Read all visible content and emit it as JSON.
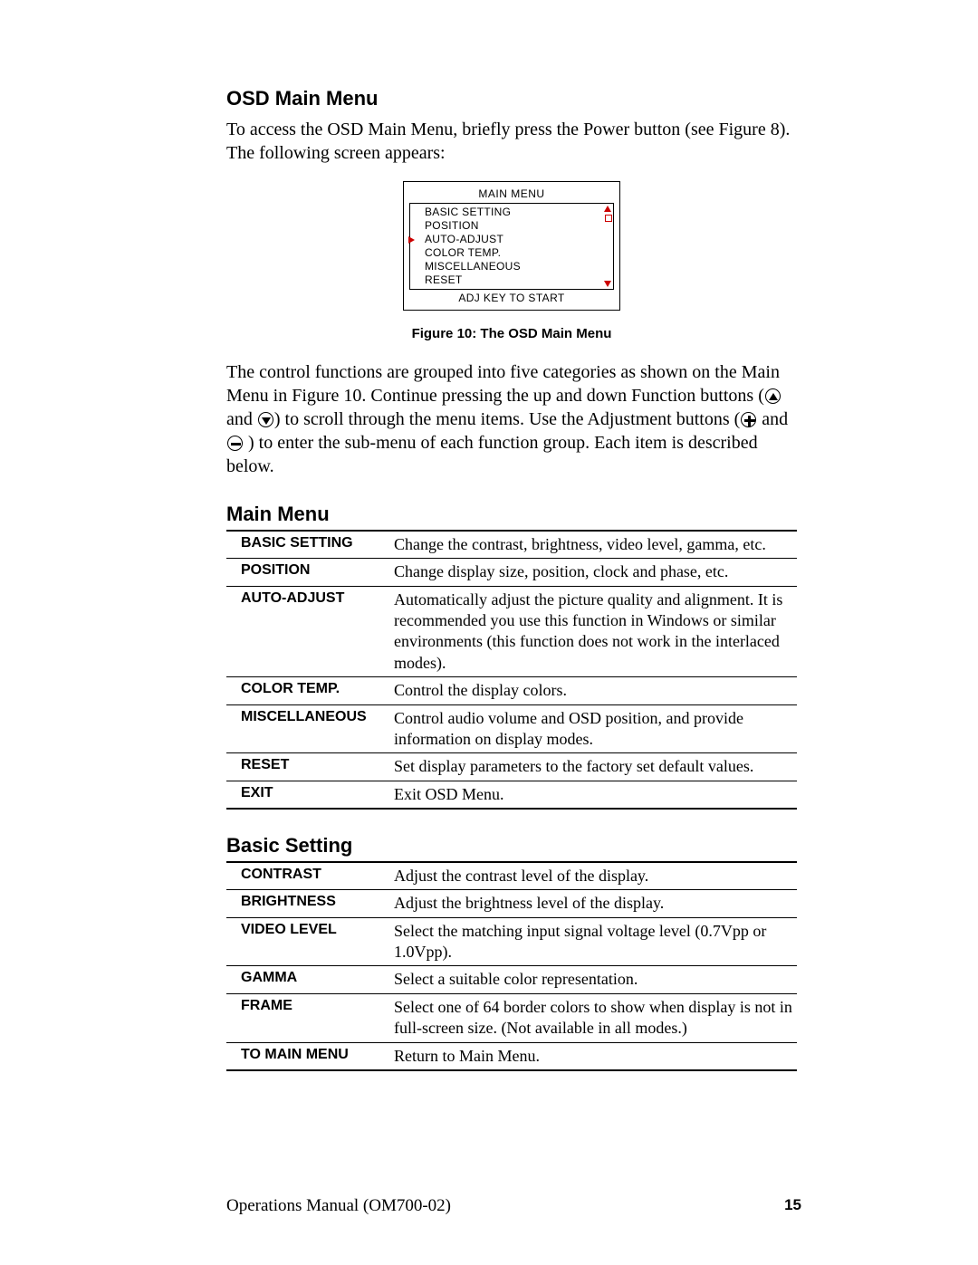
{
  "heading": "OSD Main Menu",
  "intro": "To access the OSD Main Menu, briefly press the Power button (see Figure 8). The following screen appears:",
  "figure": {
    "title": "MAIN MENU",
    "items": [
      "BASIC SETTING",
      "POSITION",
      "AUTO-ADJUST",
      "COLOR TEMP.",
      "MISCELLANEOUS",
      "RESET"
    ],
    "selected_index": 2,
    "footer": "ADJ KEY TO START",
    "caption": "Figure 10: The OSD Main Menu"
  },
  "desc": {
    "seg1": "The control functions are grouped into five categories as shown on the Main Menu in Figure 10. Continue pressing the up and down Function buttons (",
    "seg_and1": " and ",
    "seg2": ") to scroll through the menu items. Use the Adjustment buttons (",
    "seg_and2": " and ",
    "seg3": " ) to enter the sub-menu of each function group. Each item is described below."
  },
  "sections": [
    {
      "title": "Main Menu",
      "rows": [
        {
          "k": "BASIC SETTING",
          "v": "Change the contrast, brightness, video level, gamma, etc."
        },
        {
          "k": "POSITION",
          "v": "Change display size, position, clock and phase, etc."
        },
        {
          "k": "AUTO-ADJUST",
          "v": "Automatically adjust the picture quality and alignment. It is recommended you use this function in Windows or similar environments (this function does not work in the interlaced modes)."
        },
        {
          "k": "COLOR TEMP.",
          "v": "Control the display colors."
        },
        {
          "k": "MISCELLANEOUS",
          "v": "Control audio volume and OSD position, and provide information on display modes."
        },
        {
          "k": "RESET",
          "v": "Set display parameters to the factory set default values."
        },
        {
          "k": "EXIT",
          "v": "Exit OSD Menu."
        }
      ]
    },
    {
      "title": "Basic Setting",
      "rows": [
        {
          "k": "CONTRAST",
          "v": "Adjust the contrast level of the display."
        },
        {
          "k": "BRIGHTNESS",
          "v": "Adjust the brightness level of the display."
        },
        {
          "k": "VIDEO LEVEL",
          "v": "Select the matching input signal voltage level (0.7Vpp or 1.0Vpp)."
        },
        {
          "k": "GAMMA",
          "v": "Select a suitable color representation."
        },
        {
          "k": "FRAME",
          "v": "Select one of 64 border colors to show when display is not in full-screen size. (Not available in all modes.)"
        },
        {
          "k": "TO MAIN MENU",
          "v": "Return to Main Menu."
        }
      ]
    }
  ],
  "footer": {
    "left": "Operations Manual (OM700-02)",
    "page": "15"
  }
}
